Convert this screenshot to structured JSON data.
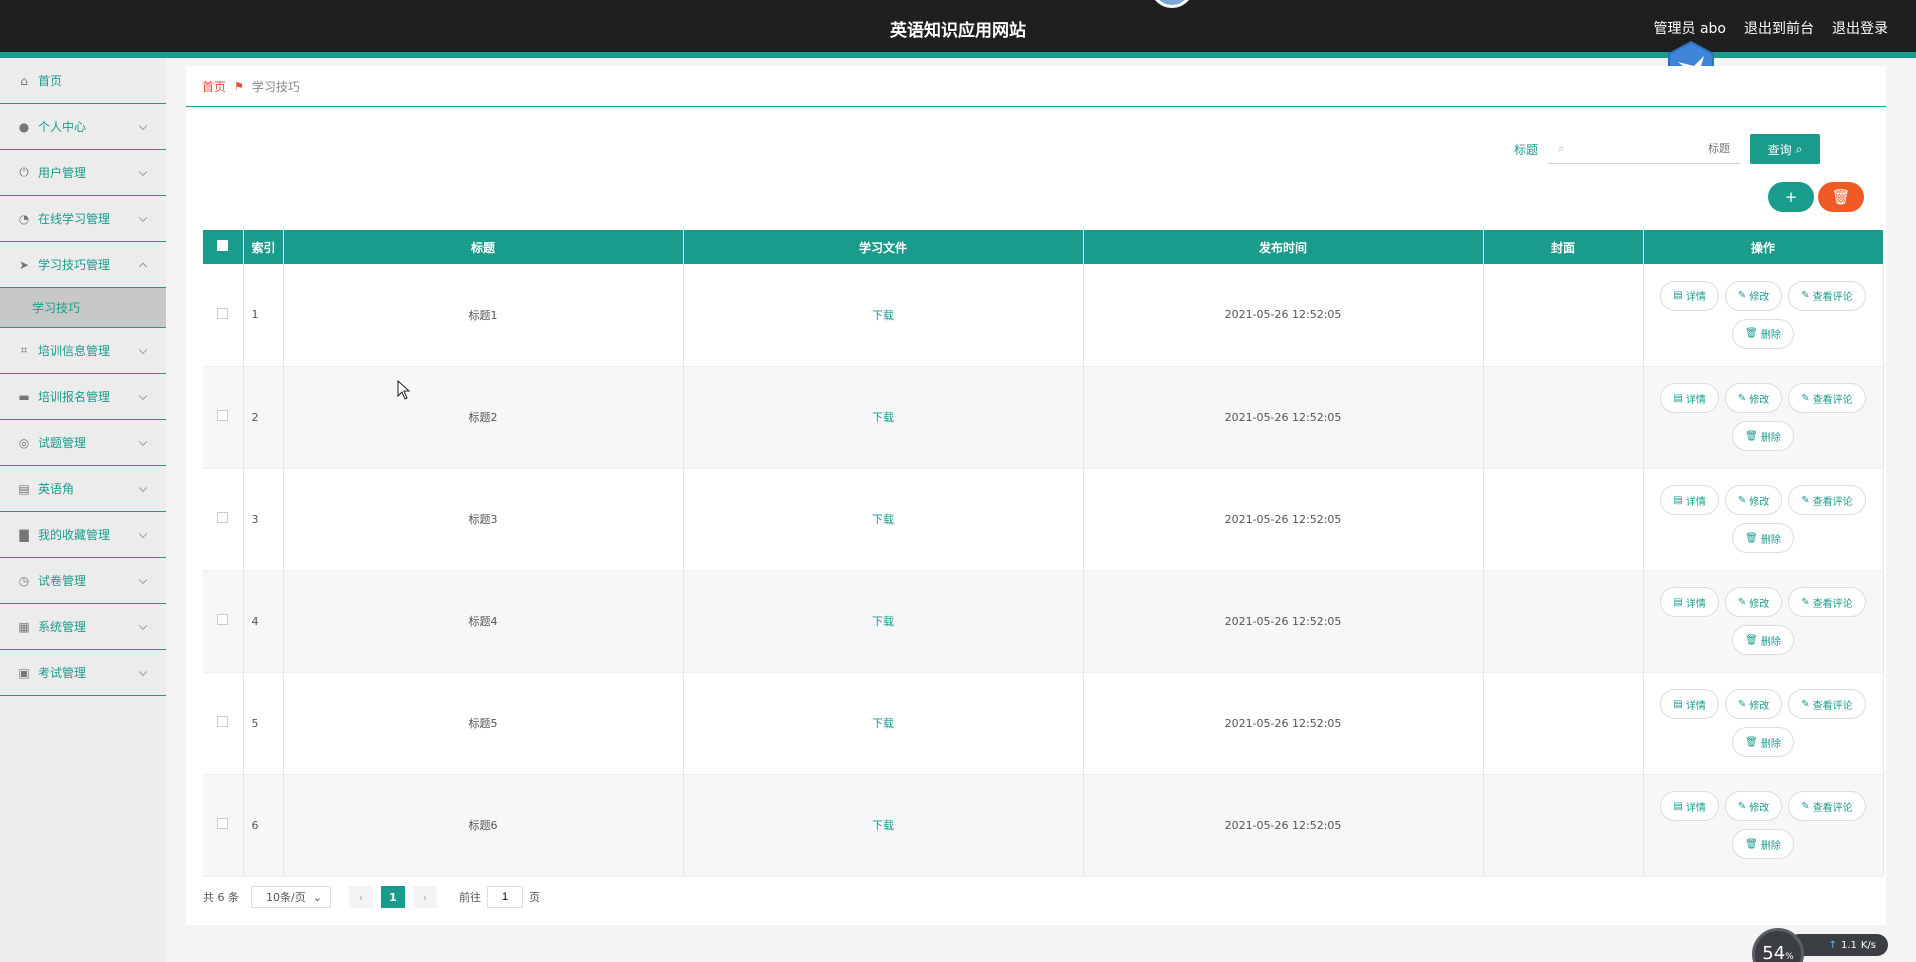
{
  "header": {
    "site_title": "英语知识应用网站",
    "user_label": "管理员 abo",
    "back_to_front": "退出到前台",
    "logout": "退出登录"
  },
  "sidebar": {
    "items": [
      {
        "label": "首页",
        "icon": "home-icon"
      },
      {
        "label": "个人中心",
        "icon": "user-icon"
      },
      {
        "label": "用户管理",
        "icon": "power-icon"
      },
      {
        "label": "在线学习管理",
        "icon": "gauge-icon"
      },
      {
        "label": "学习技巧管理",
        "icon": "send-icon"
      },
      {
        "label": "学习技巧",
        "icon": ""
      },
      {
        "label": "培训信息管理",
        "icon": "crop-icon"
      },
      {
        "label": "培训报名管理",
        "icon": "chat-icon"
      },
      {
        "label": "试题管理",
        "icon": "globe-icon"
      },
      {
        "label": "英语角",
        "icon": "briefcase-icon"
      },
      {
        "label": "我的收藏管理",
        "icon": "printer-icon"
      },
      {
        "label": "试卷管理",
        "icon": "clock-icon"
      },
      {
        "label": "系统管理",
        "icon": "clipboard-icon"
      },
      {
        "label": "考试管理",
        "icon": "clipboard-check-icon"
      }
    ]
  },
  "breadcrumb": {
    "home": "首页",
    "current": "学习技巧"
  },
  "search": {
    "label": "标题",
    "placeholder": "标题",
    "query_button": "查询"
  },
  "table": {
    "headers": {
      "index": "索引",
      "title": "标题",
      "file": "学习文件",
      "time": "发布时间",
      "cover": "封面",
      "ops": "操作"
    },
    "rows": [
      {
        "index": "1",
        "title": "标题1",
        "file": "下载",
        "time": "2021-05-26 12:52:05",
        "cover": ""
      },
      {
        "index": "2",
        "title": "标题2",
        "file": "下载",
        "time": "2021-05-26 12:52:05",
        "cover": ""
      },
      {
        "index": "3",
        "title": "标题3",
        "file": "下载",
        "time": "2021-05-26 12:52:05",
        "cover": ""
      },
      {
        "index": "4",
        "title": "标题4",
        "file": "下载",
        "time": "2021-05-26 12:52:05",
        "cover": ""
      },
      {
        "index": "5",
        "title": "标题5",
        "file": "下载",
        "time": "2021-05-26 12:52:05",
        "cover": ""
      },
      {
        "index": "6",
        "title": "标题6",
        "file": "下载",
        "time": "2021-05-26 12:52:05",
        "cover": ""
      }
    ],
    "op_labels": {
      "detail": "详情",
      "edit": "修改",
      "comments": "查看评论",
      "delete": "删除"
    }
  },
  "pager": {
    "total": "共 6 条",
    "page_size": "10条/页",
    "current_page": "1",
    "goto_prefix": "前往",
    "goto_value": "1",
    "goto_suffix": "页"
  },
  "netmon": {
    "percent": "54",
    "percent_unit": "%",
    "speed": "1.1",
    "speed_unit": "K/s"
  },
  "colors": {
    "accent": "#1a9c8c",
    "danger": "#f05a24",
    "header_bg": "#1f1f1f",
    "breadcrumb_home": "#e74c3c"
  }
}
